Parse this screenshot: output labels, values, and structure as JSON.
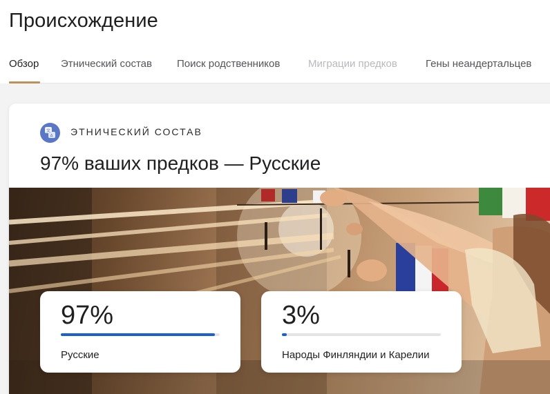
{
  "header": {
    "title": "Происхождение"
  },
  "tabs": [
    {
      "label": "Обзор",
      "state": "active"
    },
    {
      "label": "Этнический состав",
      "state": "normal"
    },
    {
      "label": "Поиск родственников",
      "state": "normal"
    },
    {
      "label": "Миграции предков",
      "state": "disabled"
    },
    {
      "label": "Гены неандертальцев",
      "state": "normal"
    }
  ],
  "card": {
    "icon": "translate-icon",
    "eyebrow": "ЭТНИЧЕСКИЙ СОСТАВ",
    "headline": "97% ваших предков — Русские",
    "image": "people-hanging-flags-photo"
  },
  "stats": [
    {
      "percent_text": "97%",
      "value": 0.97,
      "label": "Русские"
    },
    {
      "percent_text": "3%",
      "value": 0.03,
      "label": "Народы Финляндии и Карелии"
    }
  ],
  "colors": {
    "accent_underline": "#b8925a",
    "bar_fill": "#1a5fd6",
    "icon_bg": "#5a77c6"
  }
}
